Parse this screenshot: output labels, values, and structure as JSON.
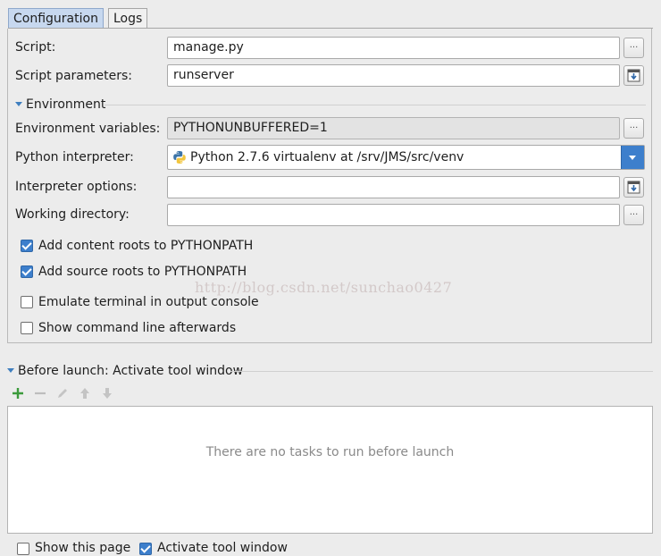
{
  "tabs": [
    {
      "label": "Configuration",
      "active": true
    },
    {
      "label": "Logs",
      "active": false
    }
  ],
  "script": {
    "label": "Script:",
    "value": "manage.py",
    "button": "..."
  },
  "script_params": {
    "label": "Script parameters:",
    "value": "runserver"
  },
  "environment": {
    "section_label": "Environment"
  },
  "env_vars": {
    "label": "Environment variables:",
    "value": "PYTHONUNBUFFERED=1",
    "button": "..."
  },
  "interpreter": {
    "label": "Python interpreter:",
    "value": "Python 2.7.6 virtualenv at /srv/JMS/src/venv"
  },
  "interp_options": {
    "label": "Interpreter options:",
    "value": ""
  },
  "working_dir": {
    "label": "Working directory:",
    "value": "",
    "button": "..."
  },
  "checkboxes": {
    "content_roots": {
      "label": "Add content roots to PYTHONPATH",
      "checked": true
    },
    "source_roots": {
      "label": "Add source roots to PYTHONPATH",
      "checked": true
    },
    "emulate_terminal": {
      "label": "Emulate terminal in output console",
      "checked": false
    },
    "show_cmdline": {
      "label": "Show command line afterwards",
      "checked": false
    }
  },
  "watermark": "http://blog.csdn.net/sunchao0427",
  "before_launch": {
    "label": "Before launch: Activate tool window",
    "empty_text": "There are no tasks to run before launch",
    "toolbar_icons": [
      "add-icon",
      "remove-icon",
      "edit-icon",
      "move-up-icon",
      "move-down-icon"
    ]
  },
  "footer": {
    "show_page": {
      "label": "Show this page",
      "checked": false
    },
    "activate_tool": {
      "label": "Activate tool window",
      "checked": true
    }
  },
  "colors": {
    "accent": "#3d7fcc",
    "add_green": "#3b9a3b"
  }
}
